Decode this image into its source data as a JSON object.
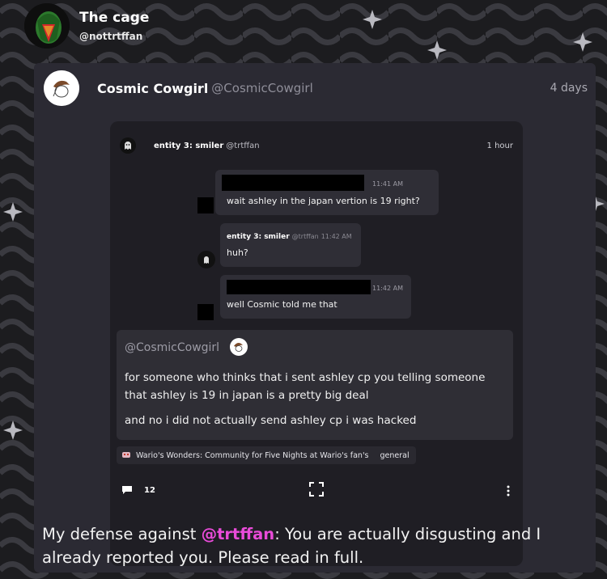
{
  "header": {
    "title": "The cage",
    "handle": "@nottrtffan"
  },
  "post": {
    "author": "Cosmic Cowgirl",
    "handle": "@CosmicCowgirl",
    "time": "4 days",
    "caption_prefix": "My defense against ",
    "caption_mention": "@trtffan",
    "caption_suffix": ": You are actually disgusting and I already reported you. Please read in full."
  },
  "screenshot": {
    "author": "entity 3: smiler",
    "handle": "@trtffan",
    "time": "1 hour",
    "messages": [
      {
        "time": "11:41 AM",
        "text": "wait ashley in the japan vertion is 19 right?"
      },
      {
        "author": "entity 3: smiler",
        "handle": "@trtffan",
        "time": "11:42 AM",
        "text": "huh?"
      },
      {
        "time": "11:42 AM",
        "text": "well Cosmic told me that"
      }
    ],
    "quote": {
      "handle": "@CosmicCowgirl",
      "line1": "for someone who thinks that i sent ashley cp you telling someone that ashley is 19 in japan is a pretty big deal",
      "line2": "and no i did not actually send ashley cp i was hacked"
    },
    "community": "Wario's Wonders: Community for Five Nights at Wario's fan's",
    "channel": "general",
    "comment_count": "12"
  },
  "icons": {
    "chat": "chat-bubble-icon",
    "expand": "expand-icon",
    "more": "more-vertical-icon"
  }
}
